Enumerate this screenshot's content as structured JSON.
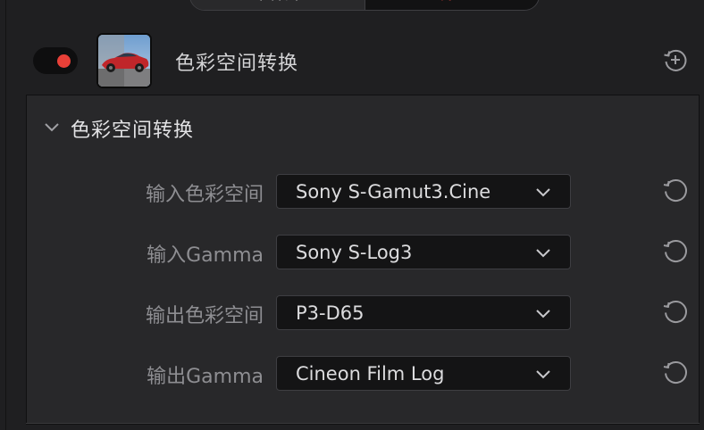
{
  "top_tabs": {
    "left_label": "采样片",
    "right_label": "设置"
  },
  "node": {
    "enabled": true,
    "title": "色彩空间转换",
    "thumbnail": "red-car-split-thumbnail",
    "add_reset_icon": "add-reset-icon"
  },
  "section": {
    "title": "色彩空间转换",
    "expanded": true,
    "rows": [
      {
        "label": "输入色彩空间",
        "value": "Sony S-Gamut3.Cine"
      },
      {
        "label": "输入Gamma",
        "value": "Sony S-Log3"
      },
      {
        "label": "输出色彩空间",
        "value": "P3-D65"
      },
      {
        "label": "输出Gamma",
        "value": "Cineon Film Log"
      }
    ]
  },
  "colors": {
    "accent_red": "#e84038",
    "panel_bg": "#28282a",
    "dropdown_bg": "#141415"
  }
}
